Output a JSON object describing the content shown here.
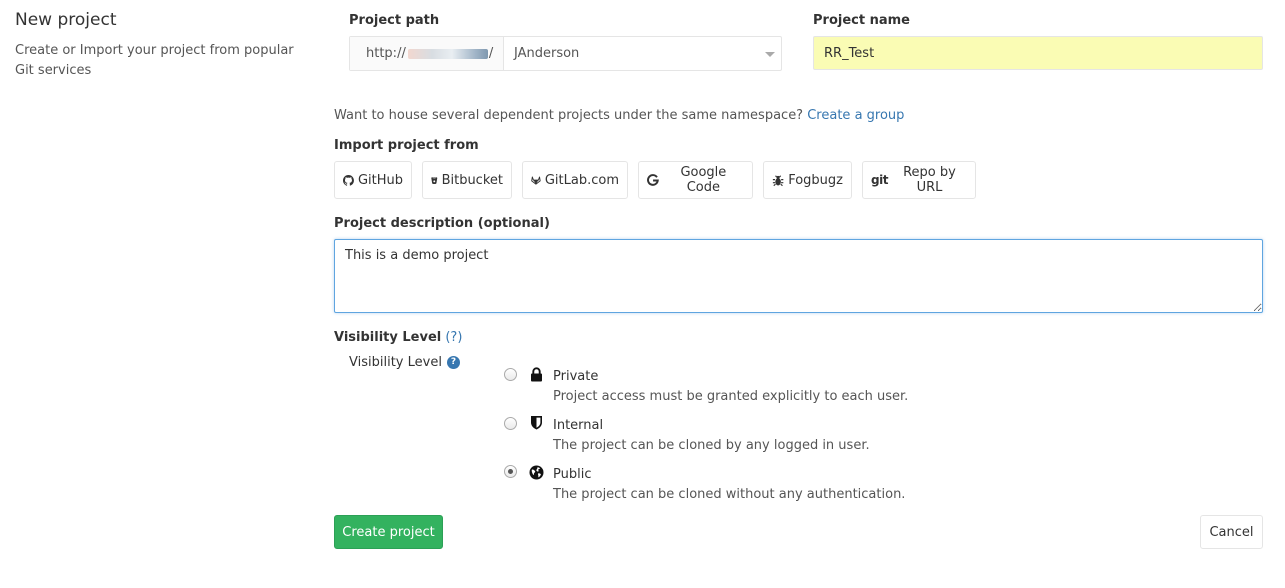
{
  "sidebar": {
    "title": "New project",
    "description": "Create or Import your project from popular Git services"
  },
  "project_path": {
    "label": "Project path",
    "prefix": "http://",
    "prefix_suffix": "/",
    "namespace": "JAnderson"
  },
  "project_name": {
    "label": "Project name",
    "value": "RR_Test"
  },
  "group_hint": {
    "text": "Want to house several dependent projects under the same namespace?",
    "link": "Create a group"
  },
  "import": {
    "label": "Import project from",
    "buttons": [
      {
        "label": "GitHub",
        "icon": "github-icon"
      },
      {
        "label": "Bitbucket",
        "icon": "bitbucket-icon"
      },
      {
        "label": "GitLab.com",
        "icon": "gitlab-icon"
      },
      {
        "label": "Google Code",
        "icon": "google-icon"
      },
      {
        "label": "Fogbugz",
        "icon": "bug-icon"
      },
      {
        "label": "Repo by URL",
        "icon": "git-icon"
      }
    ]
  },
  "description": {
    "label": "Project description (optional)",
    "value": "This is a demo project"
  },
  "visibility": {
    "label": "Visibility Level",
    "help": "(?)",
    "sub_label": "Visibility Level",
    "options": [
      {
        "title": "Private",
        "desc": "Project access must be granted explicitly to each user.",
        "icon": "lock-icon",
        "selected": false
      },
      {
        "title": "Internal",
        "desc": "The project can be cloned by any logged in user.",
        "icon": "shield-icon",
        "selected": false
      },
      {
        "title": "Public",
        "desc": "The project can be cloned without any authentication.",
        "icon": "globe-icon",
        "selected": true
      }
    ]
  },
  "actions": {
    "create": "Create project",
    "cancel": "Cancel"
  },
  "colors": {
    "primary": "#33b25f",
    "link": "#3777b0",
    "name_field_bg": "#fafcb4"
  }
}
